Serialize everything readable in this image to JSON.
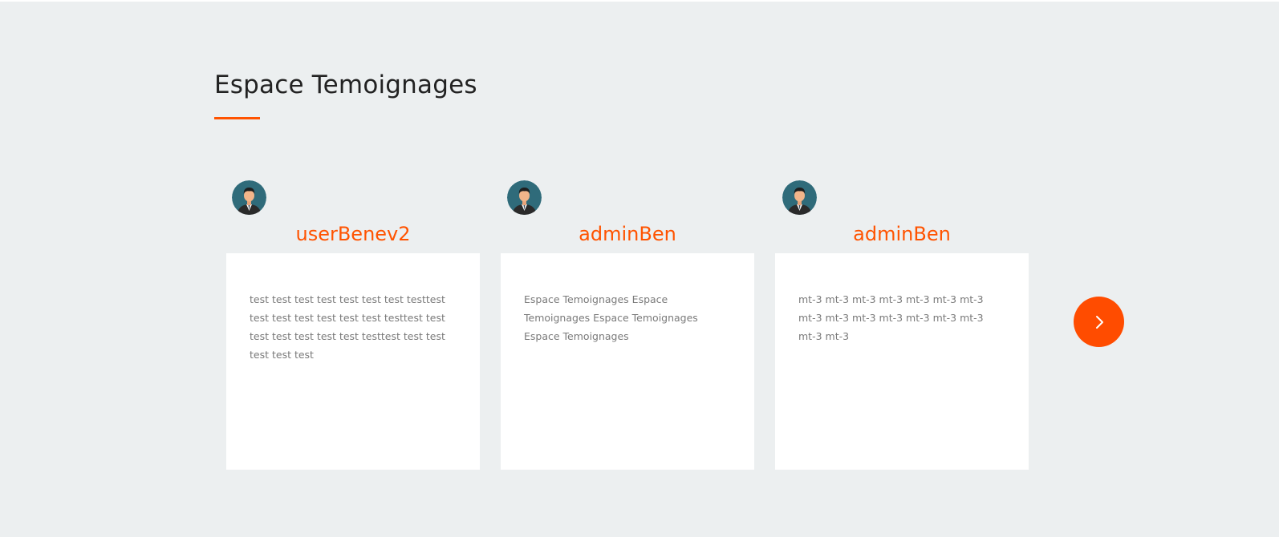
{
  "section": {
    "title": "Espace Temoignages",
    "accent_color": "#ff5300"
  },
  "testimonials": [
    {
      "avatar_icon": "user-avatar-icon",
      "name": "userBenev2",
      "text": "test test test test test test test testtest test test test test test test testtest test test test test test test testtest test test test test test"
    },
    {
      "avatar_icon": "user-avatar-icon",
      "name": "adminBen",
      "text": "Espace Temoignages Espace Temoignages Espace Temoignages Espace Temoignages"
    },
    {
      "avatar_icon": "user-avatar-icon",
      "name": "adminBen",
      "text": "mt-3 mt-3 mt-3 mt-3 mt-3 mt-3 mt-3 mt-3 mt-3 mt-3 mt-3 mt-3 mt-3 mt-3 mt-3 mt-3"
    }
  ],
  "carousel": {
    "next_icon": "chevron-right-icon",
    "next_color": "#ff4c00"
  }
}
